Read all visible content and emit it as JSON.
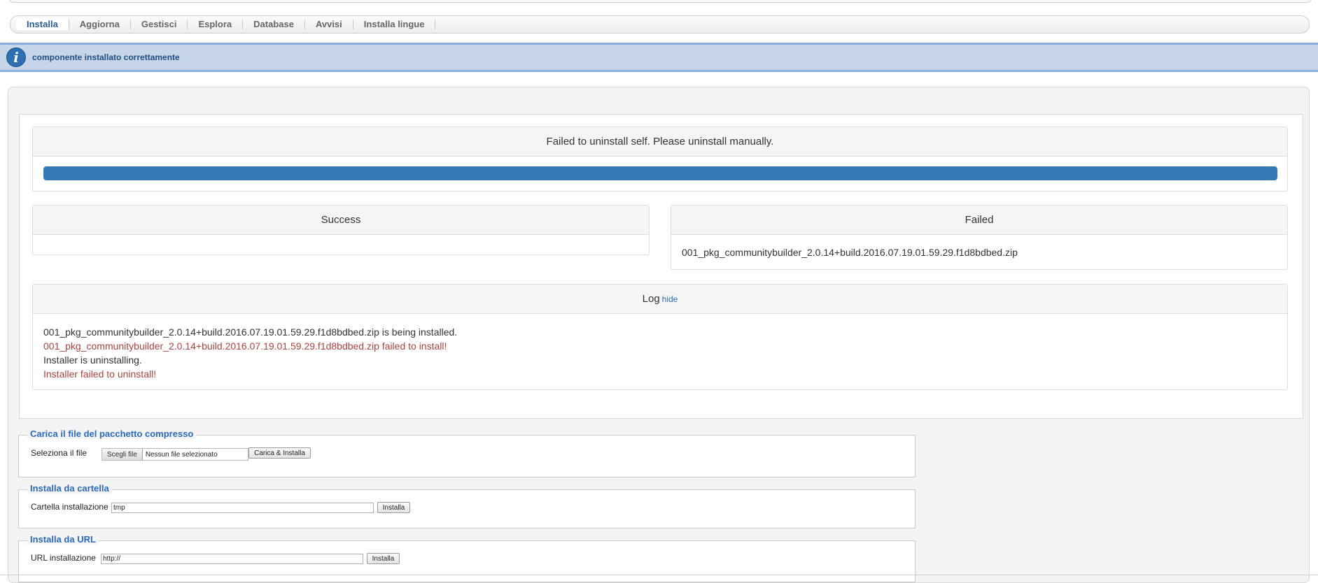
{
  "submenu": {
    "tabs": [
      {
        "label": "Installa",
        "active": true
      },
      {
        "label": "Aggiorna"
      },
      {
        "label": "Gestisci"
      },
      {
        "label": "Esplora"
      },
      {
        "label": "Database"
      },
      {
        "label": "Avvisi"
      },
      {
        "label": "Installa lingue"
      }
    ]
  },
  "message": {
    "icon": "info-icon",
    "text": "componente installato correttamente"
  },
  "status": {
    "heading": "Failed to uninstall self. Please uninstall manually.",
    "progress": 1.0,
    "progress_color": "#337ab7"
  },
  "success_panel": {
    "heading": "Success"
  },
  "failed_panel": {
    "heading": "Failed",
    "item": "001_pkg_communitybuilder_2.0.14+build.2016.07.19.01.59.29.f1d8bdbed.zip"
  },
  "log": {
    "heading": "Log",
    "toggle_label": "hide",
    "lines": [
      {
        "text": "001_pkg_communitybuilder_2.0.14+build.2016.07.19.01.59.29.f1d8bdbed.zip is being installed.",
        "error": false
      },
      {
        "text": "001_pkg_communitybuilder_2.0.14+build.2016.07.19.01.59.29.f1d8bdbed.zip failed to install!",
        "error": true
      },
      {
        "text": "Installer is uninstalling.",
        "error": false
      },
      {
        "text": "Installer failed to uninstall!",
        "error": true
      }
    ]
  },
  "upload": {
    "legend": "Carica il file del pacchetto compresso",
    "label": "Seleziona il file",
    "file_button": "Scegli file",
    "file_status": "Nessun file selezionato",
    "submit": "Carica & Installa"
  },
  "from_folder": {
    "legend": "Installa da cartella",
    "label": "Cartella installazione",
    "value": "tmp",
    "submit": "Installa"
  },
  "from_url": {
    "legend": "Installa da URL",
    "label": "URL installazione",
    "value": "http://",
    "submit": "Installa"
  }
}
